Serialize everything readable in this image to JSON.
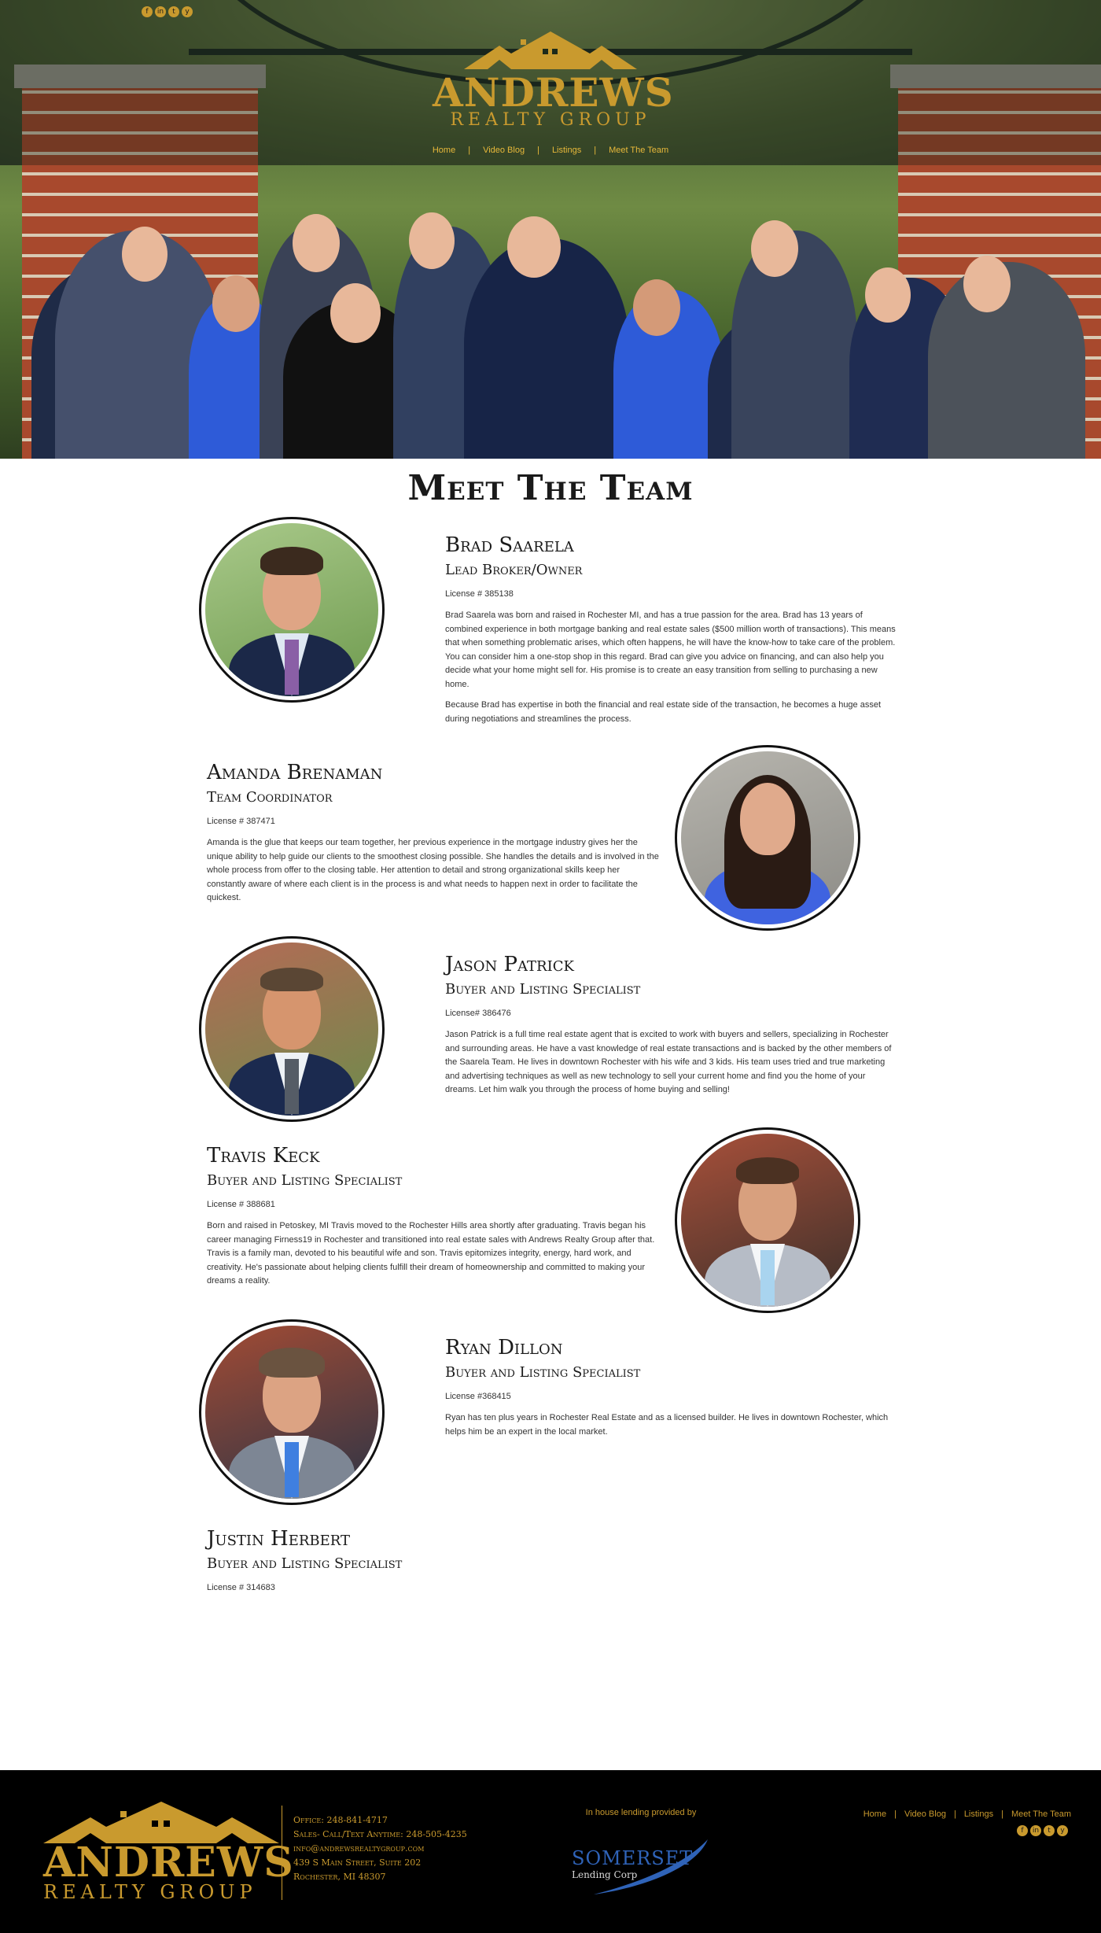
{
  "social": [
    "f",
    "in",
    "t",
    "y"
  ],
  "social_icons": [
    "facebook-icon",
    "linkedin-icon",
    "twitter-icon",
    "youtube-icon"
  ],
  "brand": {
    "word": "ANDREWS",
    "sub": "REALTY GROUP",
    "color": "#c99a2e"
  },
  "nav": {
    "items": [
      "Home",
      "Video Blog",
      "Listings",
      "Meet The Team"
    ],
    "separator": "|"
  },
  "page_title": "Meet The Team",
  "team": [
    {
      "name": "Brad Saarela",
      "role": "Lead Broker/Owner",
      "license": "License # 385138",
      "bio": [
        "Brad Saarela was born and raised in Rochester MI, and has a true passion for the area. Brad has 13 years of combined experience in both mortgage banking and real estate sales ($500 million worth of transactions). This means that when something problematic arises, which often happens, he will have the know-how to take care of the problem. You can consider him a one-stop shop in this regard. Brad can give you advice on financing, and can also help you decide what your home might sell for. His promise is to create an easy transition from selling to purchasing a new home.",
        "Because Brad has expertise in both the financial and real estate side of the transaction, he becomes a huge asset during negotiations and streamlines the process."
      ]
    },
    {
      "name": "Amanda Brenaman",
      "role": "Team Coordinator",
      "license": "License # 387471",
      "bio": [
        "Amanda is the glue that keeps our team together, her previous experience in the mortgage industry gives her the unique ability to help guide our clients to the smoothest closing possible. She handles the details and is involved in the whole process from offer to the closing table. Her attention to detail and strong organizational skills keep her constantly aware of where each client is in the process is and what needs to happen next in order to facilitate the quickest."
      ]
    },
    {
      "name": "Jason Patrick",
      "role": "Buyer and Listing Specialist",
      "license": "License# 386476",
      "bio": [
        "Jason Patrick is a full time real estate agent that is excited to work with buyers and sellers, specializing in Rochester and surrounding areas. He have a vast knowledge of real estate transactions and is backed by the other members of the Saarela Team. He lives in downtown Rochester with his wife and 3 kids. His team uses tried and true marketing and advertising techniques as well as new technology to sell your current home and find you the home of your dreams. Let him walk you through the process of home buying and selling!"
      ]
    },
    {
      "name": "Travis Keck",
      "role": "Buyer and Listing Specialist",
      "license": "License # 388681",
      "bio": [
        "Born and raised in Petoskey, MI Travis moved to the Rochester Hills area shortly after graduating. Travis began his career managing Firness19 in Rochester and transitioned into real estate sales with Andrews Realty Group after that. Travis is a family man, devoted to his beautiful wife and son. Travis epitomizes integrity, energy, hard work, and creativity. He's passionate about helping clients fulfill their dream of homeownership and committed to making your dreams a reality."
      ]
    },
    {
      "name": "Ryan Dillon",
      "role": "Buyer and Listing Specialist",
      "license": "License #368415",
      "bio": [
        "Ryan has ten plus years in Rochester Real Estate and as a licensed builder. He lives in downtown Rochester, which helps him be an expert in the local market."
      ]
    },
    {
      "name": "Justin Herbert",
      "role": "Buyer and Listing Specialist",
      "license": "License # 314683",
      "bio": []
    }
  ],
  "footer": {
    "contact": [
      "Office: 248-841-4717",
      "Sales- Call/Text Anytime: 248-505-4235",
      "info@andrewsrealtygroup.com",
      "439 S Main Street, Suite 202",
      "Rochester, MI 48307"
    ],
    "lending_label": "In house lending provided by",
    "lender_word": "SOMERSET",
    "lender_sub": "Lending Corp"
  },
  "colors": {
    "gold": "#c99a2e",
    "nav_gold": "#e8b93a",
    "footer_bg": "#000000",
    "lender_blue": "#2f63b8"
  }
}
